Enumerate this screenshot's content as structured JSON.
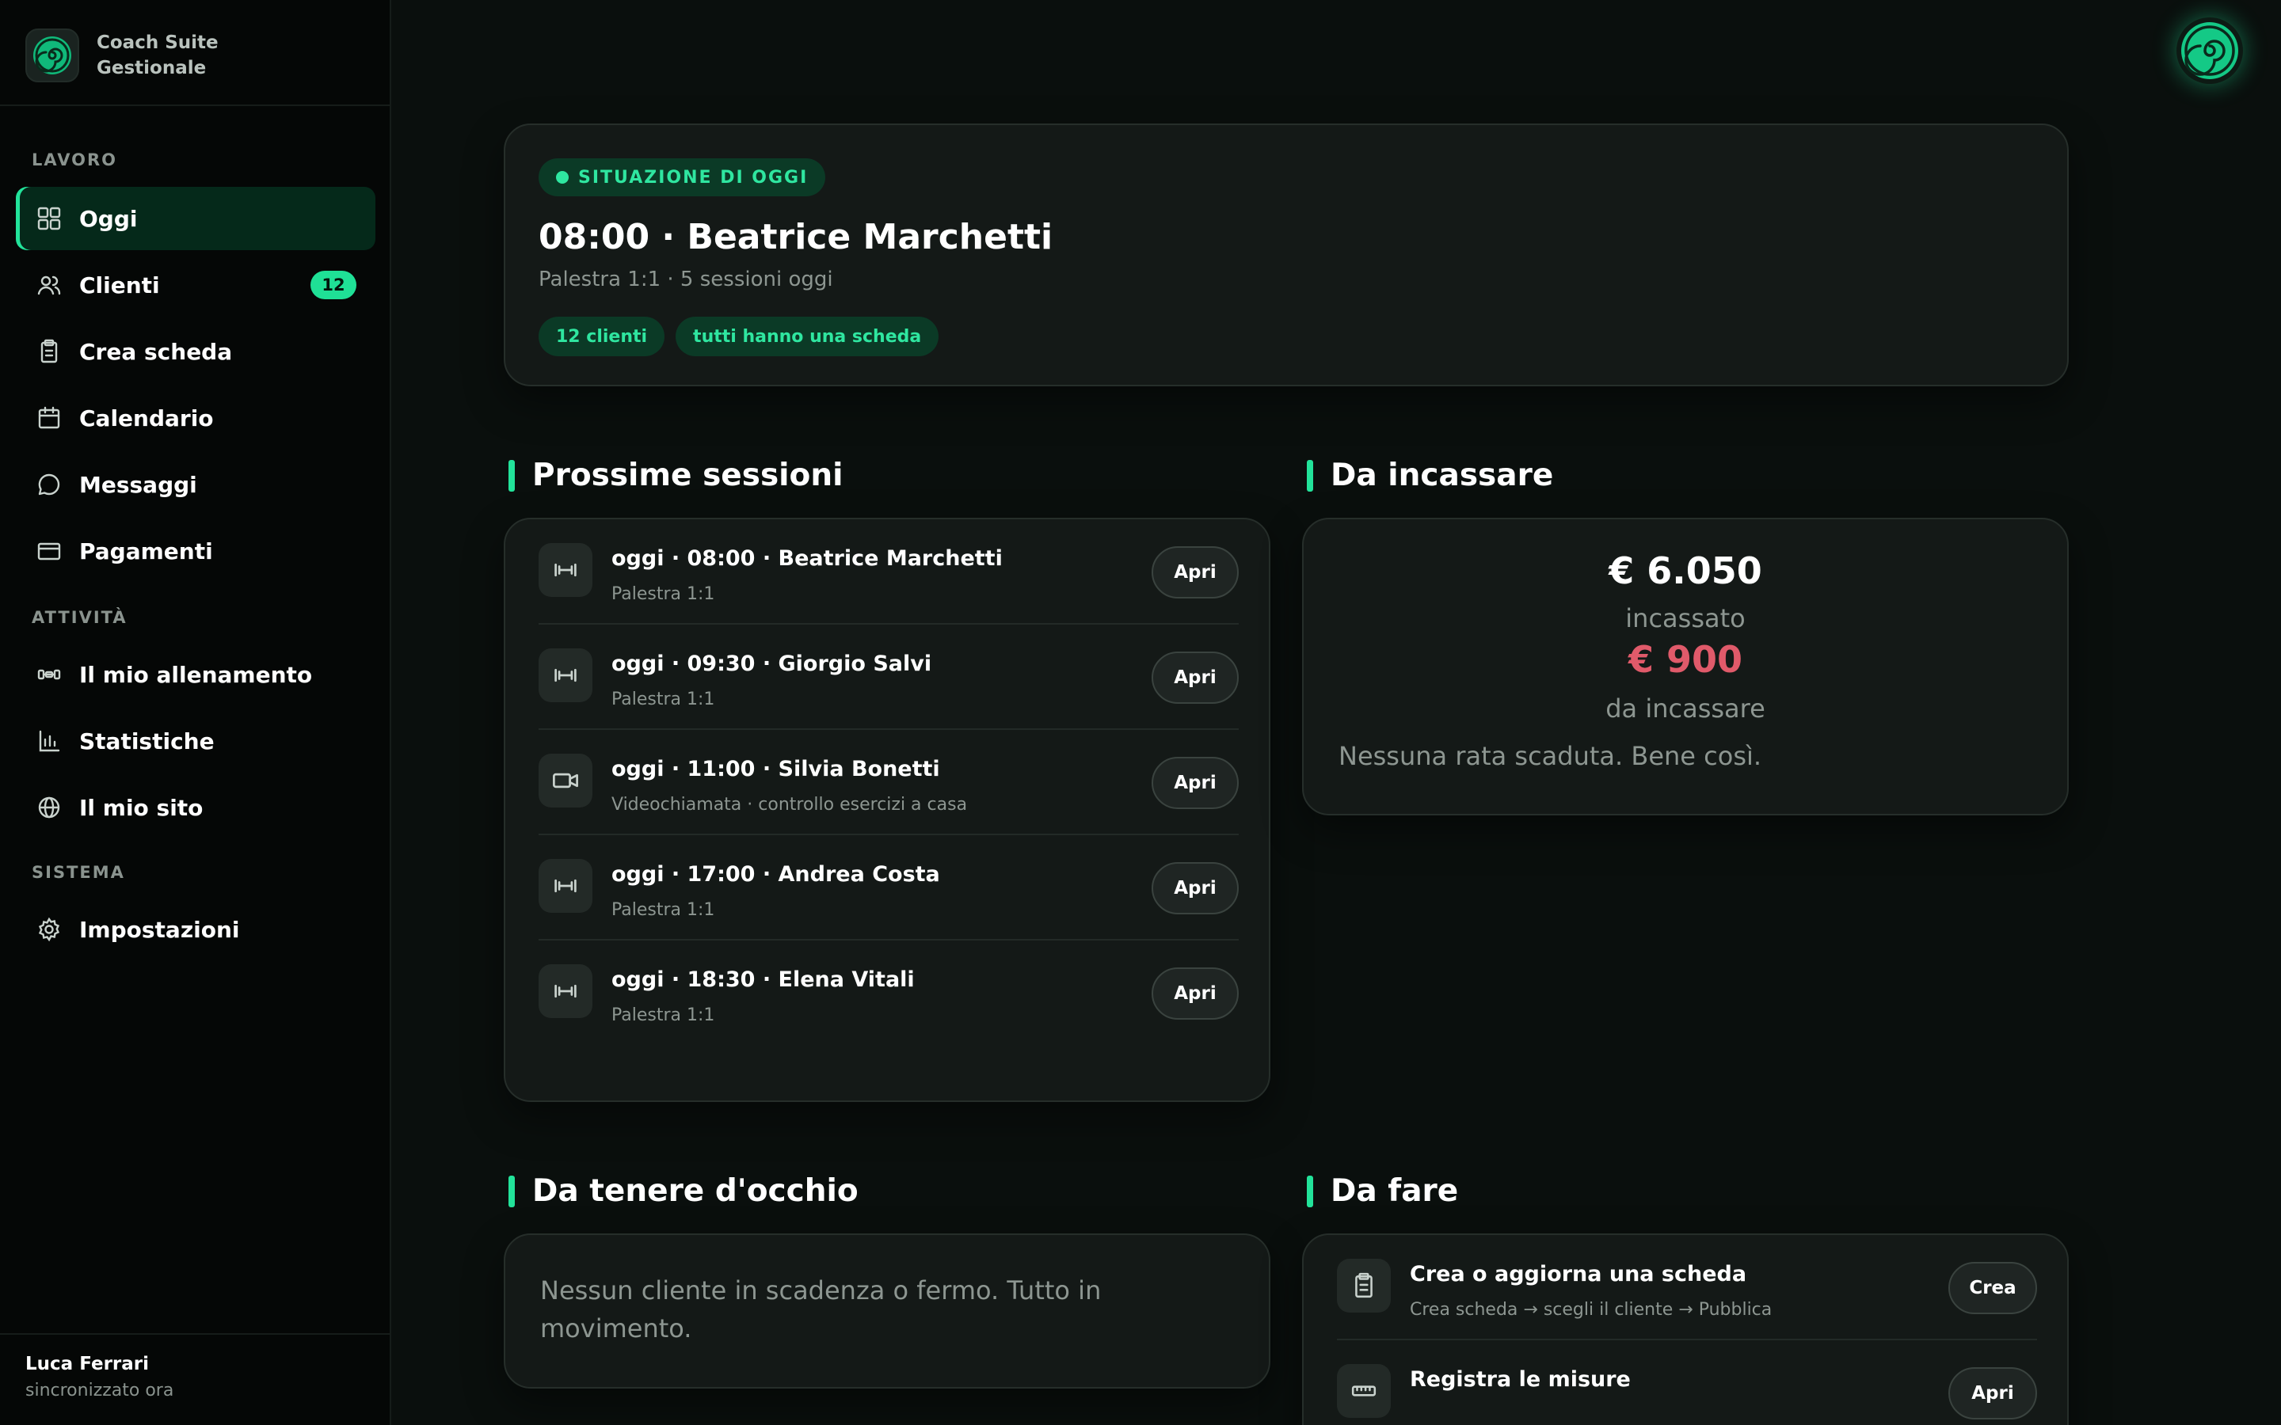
{
  "brand": {
    "name_line1": "Coach Suite",
    "name_line2": "Gestionale"
  },
  "sidebar": {
    "sections": {
      "lavoro": "LAVORO",
      "attivita": "ATTIVITÀ",
      "sistema": "SISTEMA"
    },
    "items": [
      {
        "label": "Oggi",
        "icon": "grid-icon",
        "active": true
      },
      {
        "label": "Clienti",
        "icon": "users-icon",
        "badge": "12"
      },
      {
        "label": "Crea scheda",
        "icon": "clipboard-icon"
      },
      {
        "label": "Calendario",
        "icon": "calendar-icon"
      },
      {
        "label": "Messaggi",
        "icon": "chat-icon"
      },
      {
        "label": "Pagamenti",
        "icon": "credit-card-icon"
      },
      {
        "label": "Il mio allenamento",
        "icon": "dumbbell-icon"
      },
      {
        "label": "Statistiche",
        "icon": "bar-chart-icon"
      },
      {
        "label": "Il mio sito",
        "icon": "globe-icon"
      },
      {
        "label": "Impostazioni",
        "icon": "gear-icon"
      }
    ],
    "user": {
      "name": "Luca Ferrari",
      "status": "sincronizzato ora"
    }
  },
  "hero": {
    "pill": "SITUAZIONE DI OGGI",
    "title": "08:00 · Beatrice Marchetti",
    "subtitle": "Palestra 1:1 · 5 sessioni oggi",
    "tags": [
      "12 clienti",
      "tutti hanno una scheda"
    ]
  },
  "sessions": {
    "title": "Prossime sessioni",
    "button_label": "Apri",
    "rows": [
      {
        "title": "oggi · 08:00 · Beatrice Marchetti",
        "sub": "Palestra 1:1",
        "icon": "dumbbell-icon"
      },
      {
        "title": "oggi · 09:30 · Giorgio Salvi",
        "sub": "Palestra 1:1",
        "icon": "dumbbell-icon"
      },
      {
        "title": "oggi · 11:00 · Silvia Bonetti",
        "sub": "Videochiamata · controllo esercizi a casa",
        "icon": "video-icon"
      },
      {
        "title": "oggi · 17:00 · Andrea Costa",
        "sub": "Palestra 1:1",
        "icon": "dumbbell-icon"
      },
      {
        "title": "oggi · 18:30 · Elena Vitali",
        "sub": "Palestra 1:1",
        "icon": "dumbbell-icon"
      }
    ]
  },
  "incasso": {
    "title": "Da incassare",
    "collected": "€ 6.050",
    "collected_label": "incassato",
    "due": "€ 900",
    "due_label": "da incassare",
    "note": "Nessuna rata scaduta. Bene così."
  },
  "watch": {
    "title": "Da tenere d'occhio",
    "text": "Nessun cliente in scadenza o fermo. Tutto in movimento."
  },
  "todo": {
    "title": "Da fare",
    "rows": [
      {
        "title": "Crea o aggiorna una scheda",
        "sub": "Crea scheda → scegli il cliente → Pubblica",
        "button": "Crea",
        "icon": "clipboard-icon"
      },
      {
        "title": "Registra le misure",
        "sub": "",
        "button": "Apri",
        "icon": "ruler-icon"
      }
    ]
  },
  "colors": {
    "accent": "#22e39a",
    "due": "#e05a6a",
    "background": "#0a0f0d"
  }
}
